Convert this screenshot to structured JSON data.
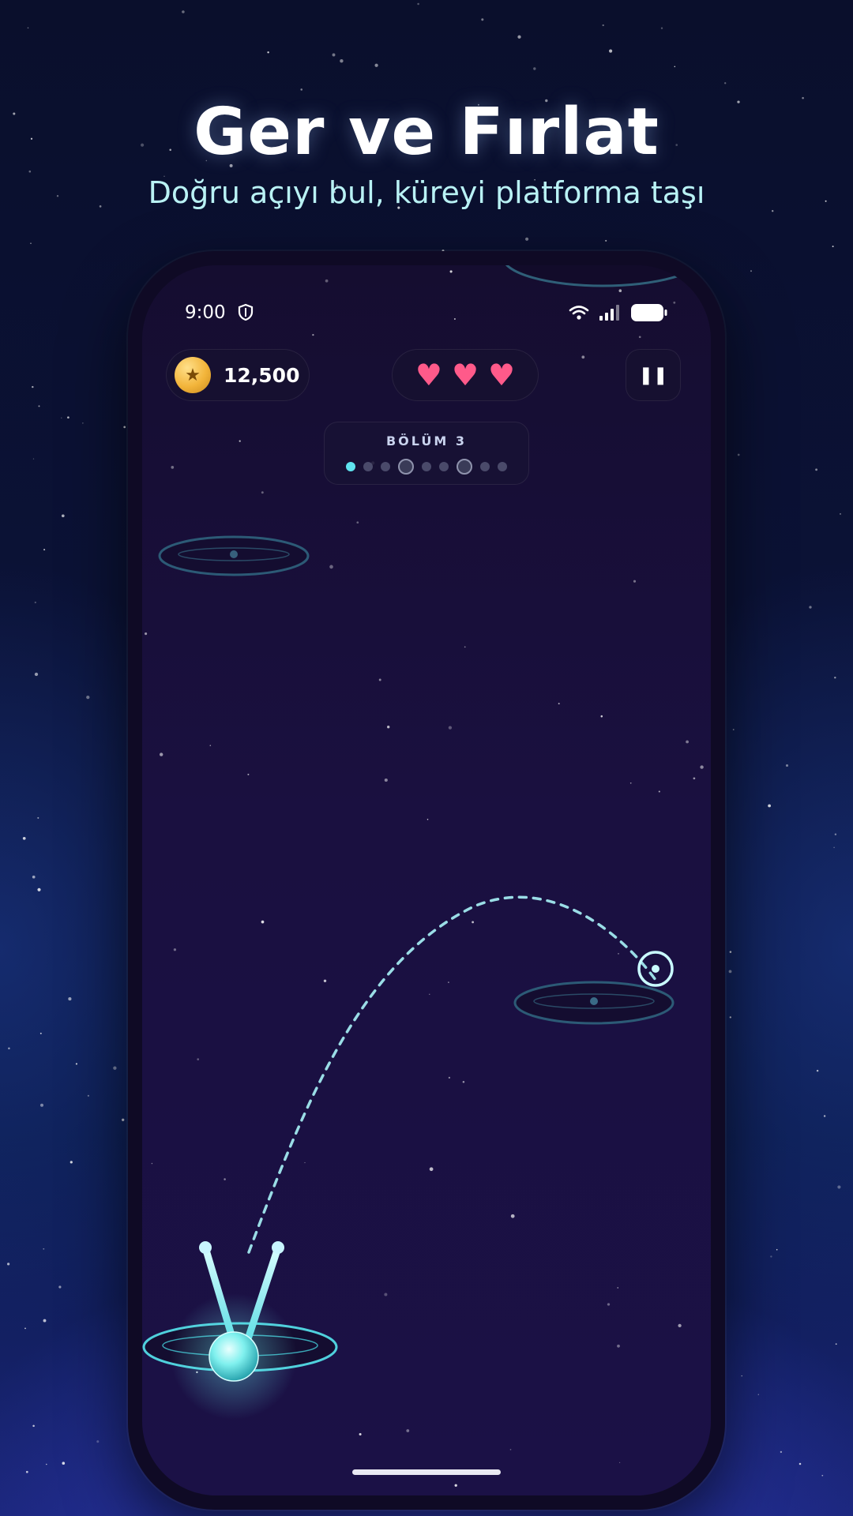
{
  "header": {
    "title": "Ger ve Fırlat",
    "subtitle": "Doğru açıyı bul, küreyi platforma taşı"
  },
  "statusbar": {
    "time": "9:00",
    "icons": [
      "shield-icon",
      "wifi-icon",
      "signal-icon",
      "battery-icon"
    ]
  },
  "hud": {
    "coins": "12,500",
    "coin_icon": "star-coin-icon",
    "lives": 3,
    "pause_icon": "pause-icon"
  },
  "level": {
    "label": "BÖLÜM 3",
    "dots": [
      {
        "state": "active"
      },
      {
        "state": "normal"
      },
      {
        "state": "normal"
      },
      {
        "state": "milestone"
      },
      {
        "state": "normal"
      },
      {
        "state": "normal"
      },
      {
        "state": "milestone"
      },
      {
        "state": "normal"
      },
      {
        "state": "normal"
      }
    ]
  },
  "colors": {
    "accent": "#5fe3ef",
    "heart": "#ff5a8a",
    "coin": "#f2b43a"
  }
}
